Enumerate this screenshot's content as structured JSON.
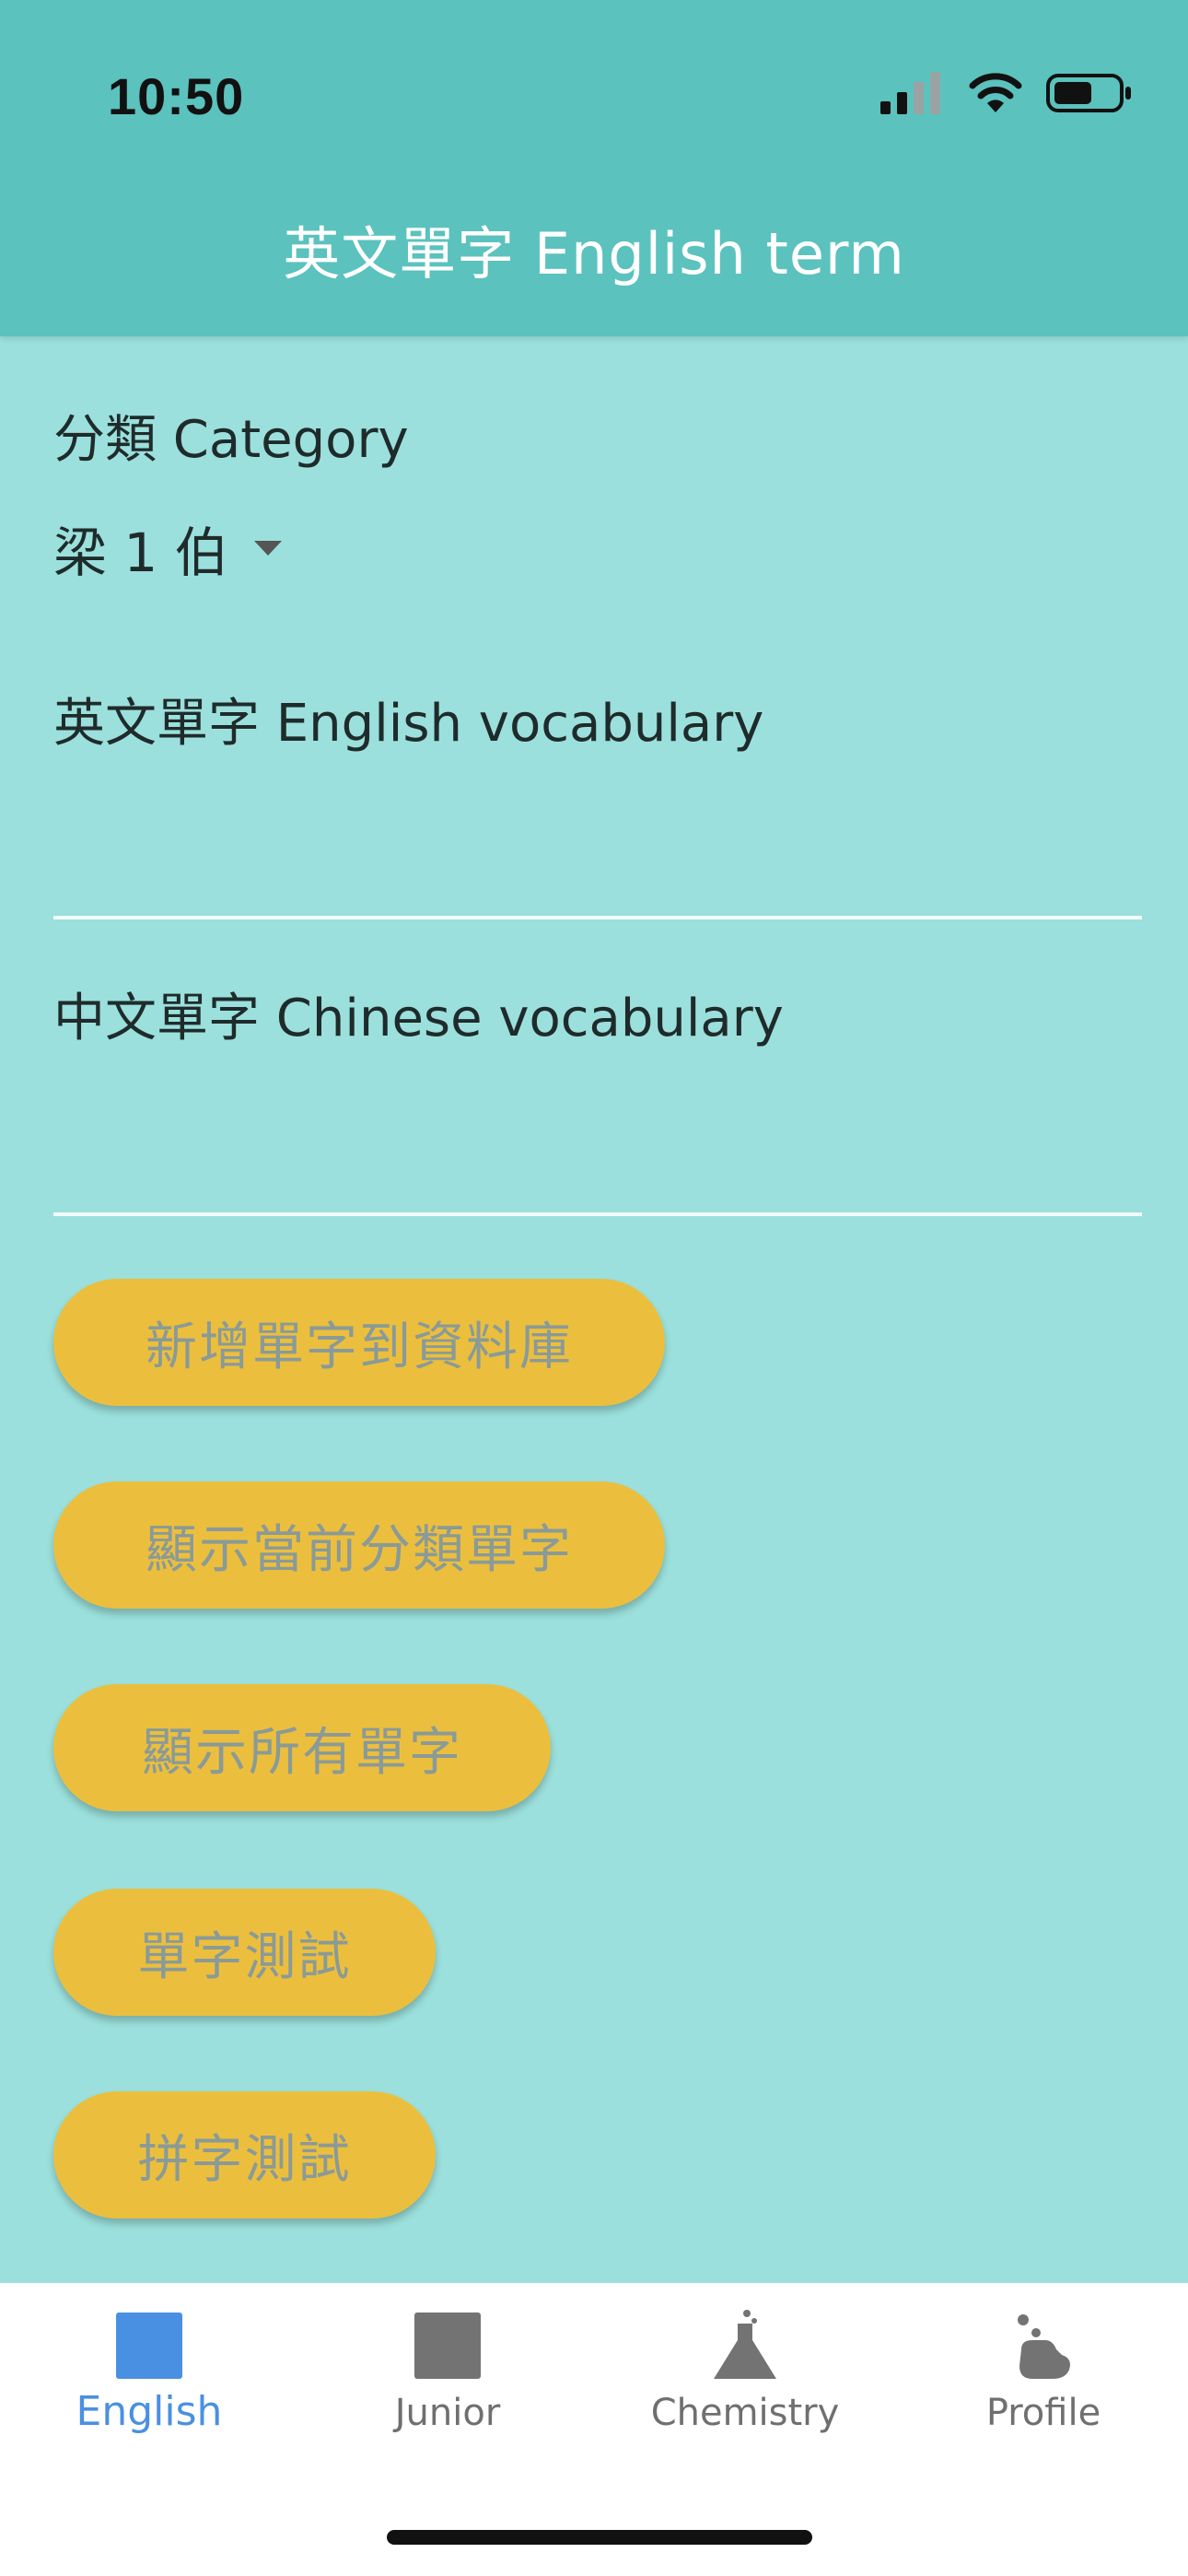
{
  "status_bar": {
    "time": "10:50"
  },
  "header": {
    "title": "英文單字 English term"
  },
  "form": {
    "category_label": "分類 Category",
    "category_value": "梁 1 伯",
    "english_label": "英文單字 English vocabulary",
    "english_value": "",
    "chinese_label": "中文單字 Chinese vocabulary",
    "chinese_value": ""
  },
  "actions": {
    "add_label": "新增單字到資料庫",
    "show_category_label": "顯示當前分類單字",
    "show_all_label": "顯示所有單字",
    "word_test_label": "單字測試",
    "spell_test_label": "拼字測試"
  },
  "tabs": [
    {
      "label": "English",
      "icon": "square-icon",
      "active": true
    },
    {
      "label": "Junior",
      "icon": "square-icon",
      "active": false
    },
    {
      "label": "Chemistry",
      "icon": "flask-icon",
      "active": false
    },
    {
      "label": "Profile",
      "icon": "bubbles-icon",
      "active": false
    }
  ],
  "colors": {
    "header_bg": "#5BC2BE",
    "content_bg": "#9BE0DC",
    "button_bg": "#EBBF3D",
    "button_text": "#8A9A98",
    "tab_active": "#4A90E2",
    "tab_inactive": "#6F6F6F"
  }
}
